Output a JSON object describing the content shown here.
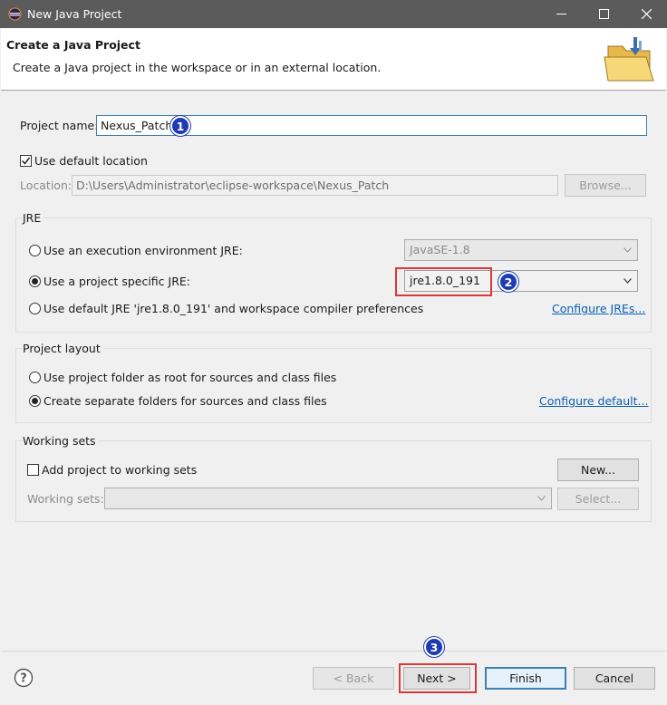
{
  "window": {
    "title": "New Java Project"
  },
  "header": {
    "title": "Create a Java Project",
    "description": "Create a Java project in the workspace or in an external location."
  },
  "project_name": {
    "label": "Project name:",
    "value": "Nexus_Patch"
  },
  "location": {
    "use_default_label": "Use default location",
    "use_default_checked": true,
    "label": "Location:",
    "value": "D:\\Users\\Administrator\\eclipse-workspace\\Nexus_Patch",
    "browse_label": "Browse..."
  },
  "jre": {
    "title": "JRE",
    "option_env_label": "Use an execution environment JRE:",
    "option_env_value": "JavaSE-1.8",
    "option_specific_label": "Use a project specific JRE:",
    "option_specific_value": "jre1.8.0_191",
    "option_default_label": "Use default JRE 'jre1.8.0_191' and workspace compiler preferences",
    "configure_link": "Configure JREs...",
    "selected": "specific"
  },
  "project_layout": {
    "title": "Project layout",
    "option_root_label": "Use project folder as root for sources and class files",
    "option_separate_label": "Create separate folders for sources and class files",
    "configure_link": "Configure default...",
    "selected": "separate"
  },
  "working_sets": {
    "title": "Working sets",
    "add_label": "Add project to working sets",
    "add_checked": false,
    "new_label": "New...",
    "sets_label": "Working sets:",
    "select_label": "Select..."
  },
  "footer": {
    "back_label": "< Back",
    "next_label": "Next >",
    "finish_label": "Finish",
    "cancel_label": "Cancel"
  },
  "annotations": {
    "badge1": "1",
    "badge2": "2",
    "badge3": "3"
  },
  "colors": {
    "titlebar": "#5b5b5b",
    "badge": "#1f3bb4",
    "highlight_box": "#d73838",
    "link": "#0b5fb5"
  }
}
